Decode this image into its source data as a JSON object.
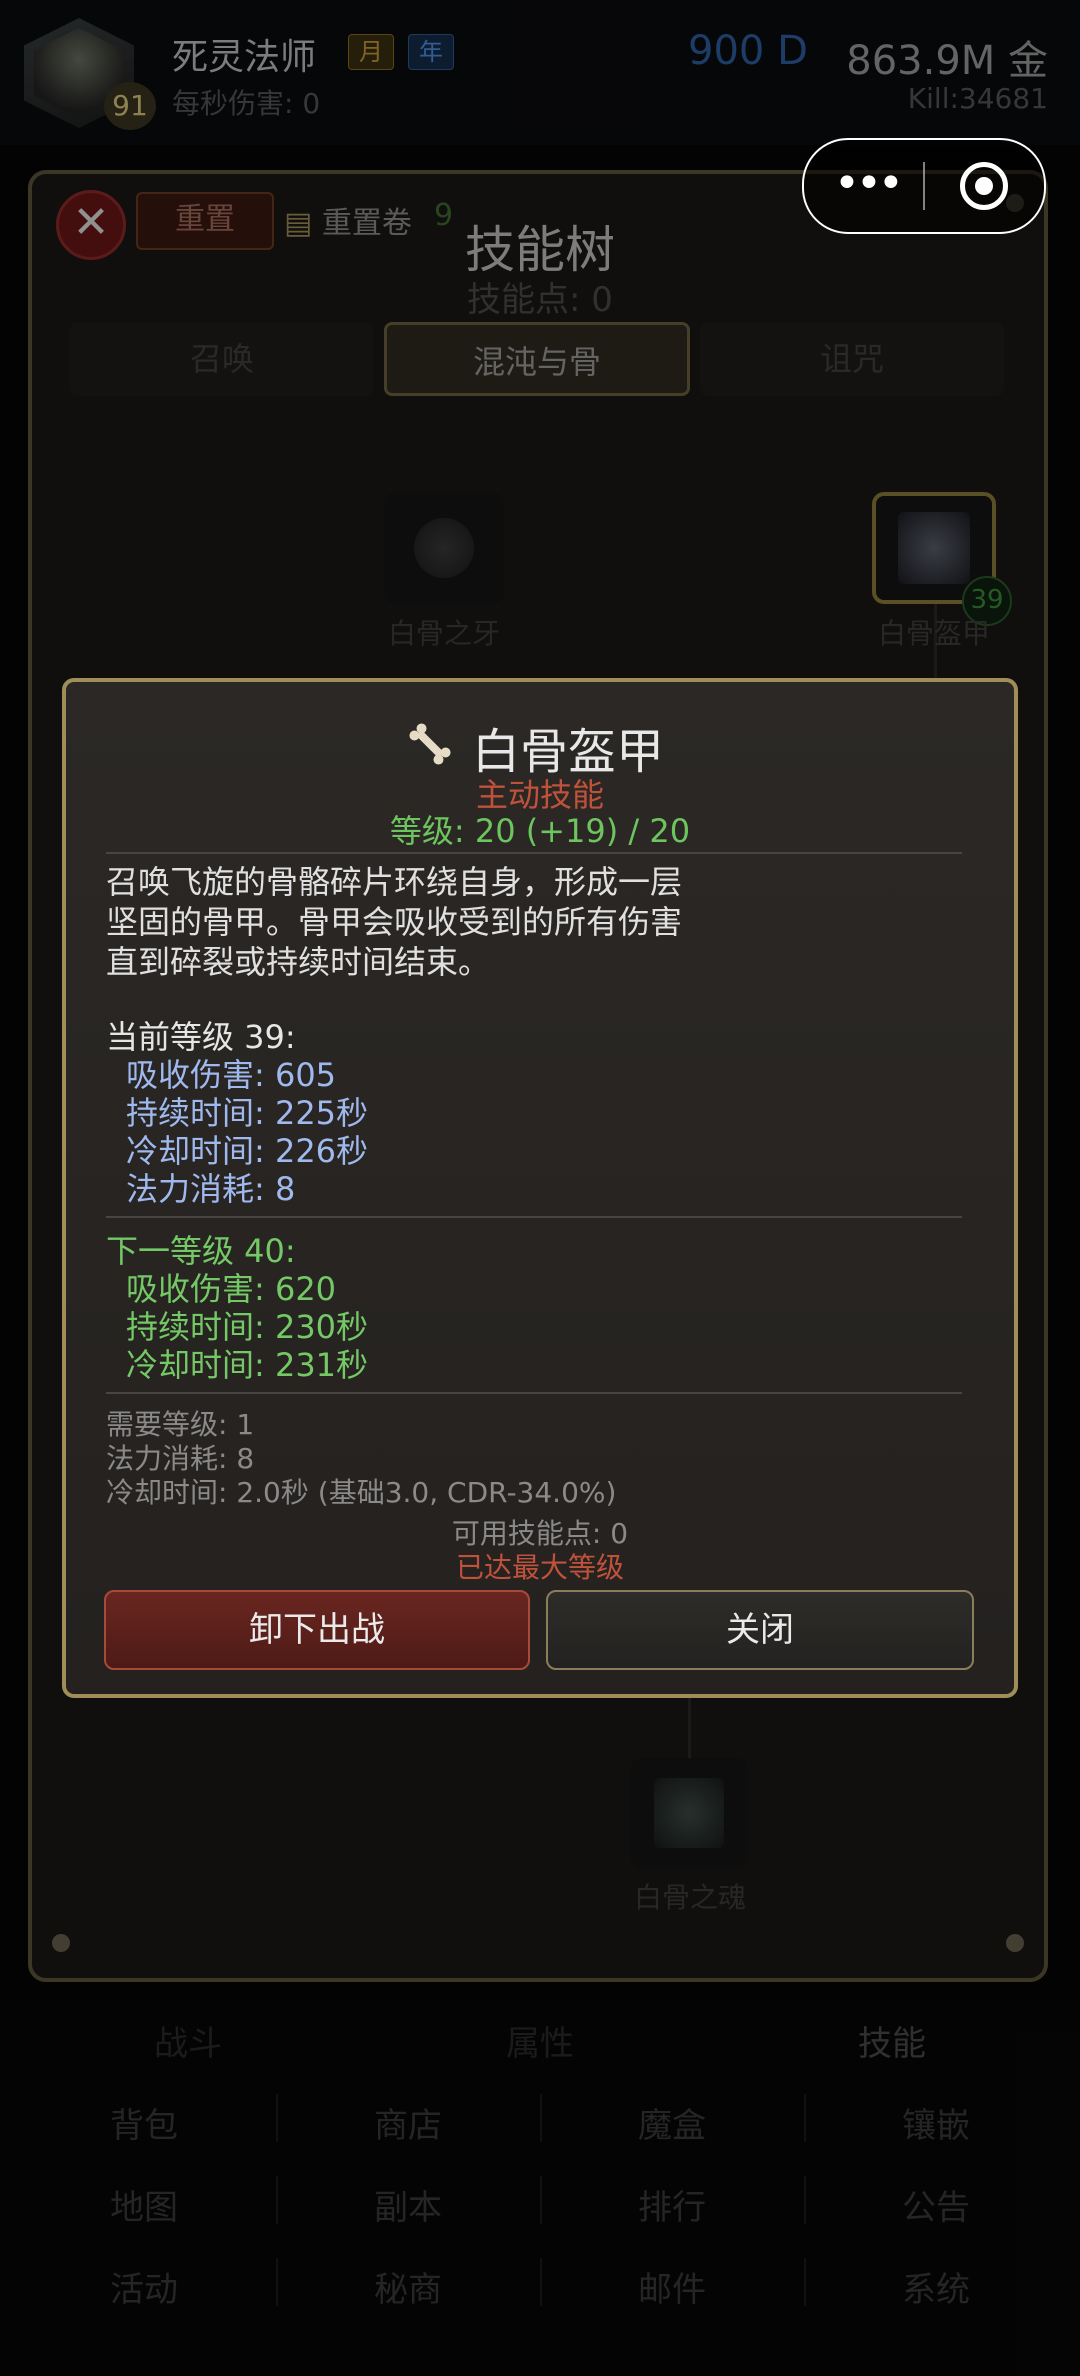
{
  "header": {
    "hero_name": "死灵法师",
    "tag_month": "月",
    "tag_year": "年",
    "hero_level": "91",
    "dps": "每秒伤害: 0",
    "currency_d": "900 D",
    "gold": "863.9M 金",
    "kill": "Kill:34681"
  },
  "panel": {
    "reset_label": "重置",
    "scroll_label": "重置卷",
    "scroll_count": "9",
    "title": "技能树",
    "skill_points": "技能点: 0",
    "tabs": [
      {
        "label": "召唤"
      },
      {
        "label": "混沌与骨"
      },
      {
        "label": "诅咒"
      }
    ],
    "nodes": [
      {
        "label": "白骨之牙",
        "icon": "bone-fang-icon"
      },
      {
        "label": "白骨盔甲",
        "icon": "bone-armor-icon",
        "level": "39"
      },
      {
        "label": "白骨之魂",
        "icon": "bone-spirit-icon"
      }
    ]
  },
  "dialog": {
    "title": "白骨盔甲",
    "type": "主动技能",
    "level_line": "等级: 20 (+19) / 20",
    "description": [
      "召唤飞旋的骨骼碎片环绕自身，形成一层",
      "坚固的骨甲。骨甲会吸收受到的所有伤害",
      "直到碎裂或持续时间结束。"
    ],
    "current_header": "当前等级 39:",
    "current_stats": [
      "吸收伤害: 605",
      "持续时间: 225秒",
      "冷却时间: 226秒",
      "法力消耗: 8"
    ],
    "next_header": "下一等级 40:",
    "next_stats": [
      "吸收伤害: 620",
      "持续时间: 230秒",
      "冷却时间: 231秒"
    ],
    "requirements": [
      "需要等级: 1",
      "法力消耗: 8",
      "冷却时间: 2.0秒 (基础3.0, CDR-34.0%)"
    ],
    "available_points": "可用技能点: 0",
    "max_level_notice": "已达最大等级",
    "unequip_button": "卸下出战",
    "close_button": "关闭"
  },
  "bottom_nav": {
    "main": [
      {
        "label": "战斗"
      },
      {
        "label": "属性"
      },
      {
        "label": "技能"
      }
    ],
    "grid": [
      {
        "label": "背包"
      },
      {
        "label": "商店"
      },
      {
        "label": "魔盒"
      },
      {
        "label": "镶嵌"
      },
      {
        "label": "地图"
      },
      {
        "label": "副本"
      },
      {
        "label": "排行"
      },
      {
        "label": "公告"
      },
      {
        "label": "活动"
      },
      {
        "label": "秘商"
      },
      {
        "label": "邮件"
      },
      {
        "label": "系统"
      }
    ]
  },
  "colors": {
    "accent_gold": "#a08e5a",
    "active_skill": "#c0523c",
    "level_green": "#6ec45e",
    "stat_blue": "#9fb9ee"
  }
}
